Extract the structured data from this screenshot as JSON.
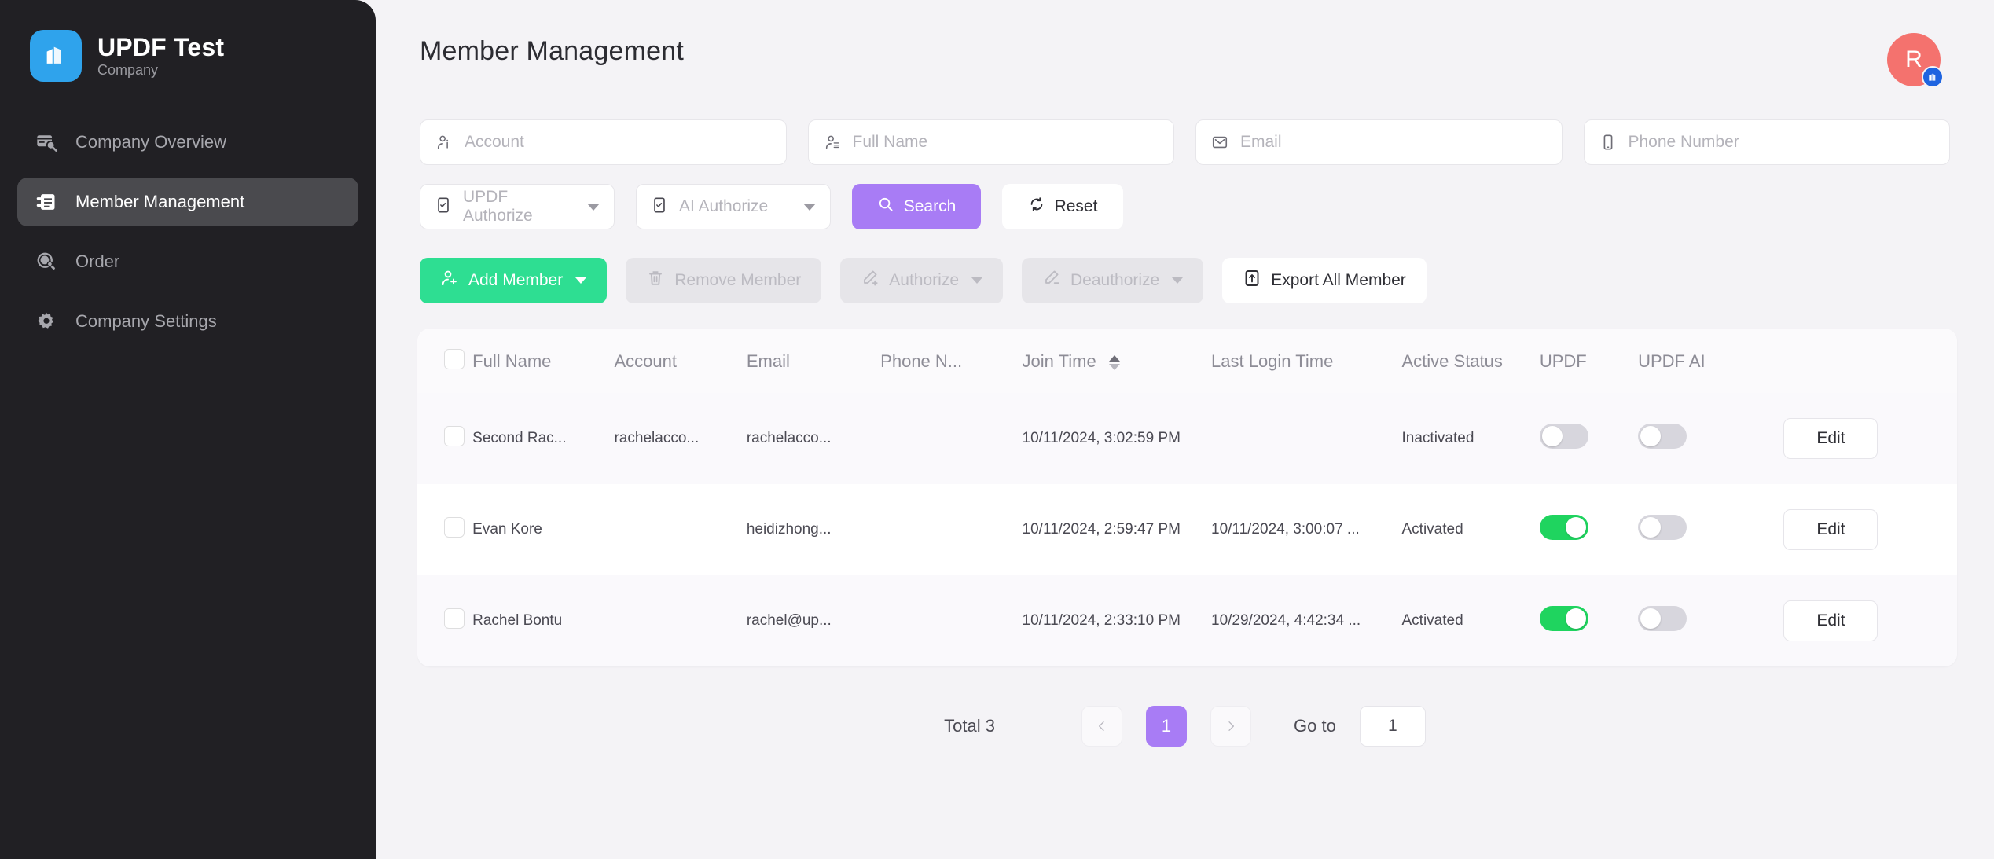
{
  "colors": {
    "sidebar_bg": "#212024",
    "page_bg": "#f4f3f6",
    "brand_blue": "#2fa3ec",
    "accent_purple": "#a87cf5",
    "accent_green": "#2ede92",
    "toggle_on_green": "#1fd45f",
    "avatar_red": "#f4726e",
    "badge_blue": "#1f64e0"
  },
  "sidebar": {
    "brand": {
      "title": "UPDF Test",
      "subtitle": "Company",
      "logo_icon": "building-icon"
    },
    "items": [
      {
        "label": "Company Overview",
        "icon": "card-search-icon",
        "active": false
      },
      {
        "label": "Member Management",
        "icon": "member-list-icon",
        "active": true
      },
      {
        "label": "Order",
        "icon": "order-icon",
        "active": false
      },
      {
        "label": "Company Settings",
        "icon": "gear-icon",
        "active": false
      }
    ]
  },
  "header": {
    "title": "Member Management",
    "avatar_initial": "R",
    "avatar_badge_icon": "building-badge-icon"
  },
  "filters": {
    "account": {
      "placeholder": "Account",
      "value": "",
      "icon": "user-account-icon"
    },
    "full_name": {
      "placeholder": "Full Name",
      "value": "",
      "icon": "user-name-icon"
    },
    "email": {
      "placeholder": "Email",
      "value": "",
      "icon": "envelope-icon"
    },
    "phone": {
      "placeholder": "Phone Number",
      "value": "",
      "icon": "phone-icon"
    },
    "updf_authorize": {
      "label": "UPDF Authorize",
      "icon": "checkbox-doc-icon"
    },
    "ai_authorize": {
      "label": "AI Authorize",
      "icon": "checkbox-doc-icon"
    },
    "search_button": {
      "label": "Search",
      "icon": "search-icon"
    },
    "reset_button": {
      "label": "Reset",
      "icon": "refresh-icon"
    }
  },
  "actions": [
    {
      "label": "Add Member",
      "icon": "user-plus-icon",
      "state": "enabled",
      "has_caret": true
    },
    {
      "label": "Remove Member",
      "icon": "trash-icon",
      "state": "disabled",
      "has_caret": false
    },
    {
      "label": "Authorize",
      "icon": "pen-plus-icon",
      "state": "disabled",
      "has_caret": true
    },
    {
      "label": "Deauthorize",
      "icon": "pen-minus-icon",
      "state": "disabled",
      "has_caret": true
    },
    {
      "label": "Export All Member",
      "icon": "export-icon",
      "state": "enabled",
      "has_caret": false
    }
  ],
  "table": {
    "columns": [
      {
        "key": "check",
        "label": ""
      },
      {
        "key": "name",
        "label": "Full Name"
      },
      {
        "key": "acct",
        "label": "Account"
      },
      {
        "key": "email",
        "label": "Email"
      },
      {
        "key": "phone",
        "label": "Phone N..."
      },
      {
        "key": "join",
        "label": "Join Time",
        "sortable": true
      },
      {
        "key": "last",
        "label": "Last Login Time"
      },
      {
        "key": "status",
        "label": "Active Status"
      },
      {
        "key": "updf",
        "label": "UPDF"
      },
      {
        "key": "ai",
        "label": "UPDF AI"
      },
      {
        "key": "edit",
        "label": ""
      }
    ],
    "edit_label": "Edit",
    "rows": [
      {
        "name": "Second Rac...",
        "acct": "rachelacco...",
        "email": "rachelacco...",
        "phone": "",
        "join": "10/11/2024, 3:02:59 PM",
        "last": "",
        "status": "Inactivated",
        "updf_on": false,
        "ai_on": false,
        "checked": false
      },
      {
        "name": "Evan Kore",
        "acct": "",
        "email": "heidizhong...",
        "phone": "",
        "join": "10/11/2024, 2:59:47 PM",
        "last": "10/11/2024, 3:00:07 ...",
        "status": "Activated",
        "updf_on": true,
        "ai_on": false,
        "checked": false
      },
      {
        "name": "Rachel Bontu",
        "acct": "",
        "email": "rachel@up...",
        "phone": "",
        "join": "10/11/2024, 2:33:10 PM",
        "last": "10/29/2024, 4:42:34 ...",
        "status": "Activated",
        "updf_on": true,
        "ai_on": false,
        "checked": false
      }
    ]
  },
  "pagination": {
    "total_text": "Total 3",
    "prev_icon": "chevron-left-icon",
    "next_icon": "chevron-right-icon",
    "current_page": "1",
    "goto_label": "Go to",
    "goto_value": "1"
  }
}
